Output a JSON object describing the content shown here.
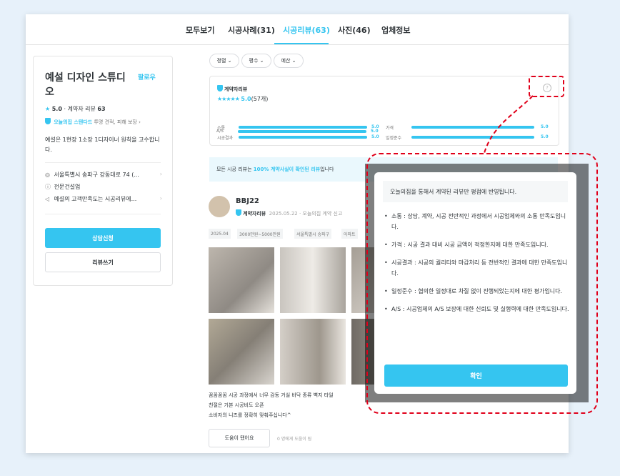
{
  "tabs": [
    {
      "label": "모두보기"
    },
    {
      "label": "시공사례(31)"
    },
    {
      "label": "시공리뷰(63)",
      "active": true
    },
    {
      "label": "사진(46)"
    },
    {
      "label": "업체정보"
    }
  ],
  "business": {
    "name": "예설 디자인 스튜디오",
    "follow_label": "팔로우",
    "rating": "5.0",
    "contract_reviews_prefix": "· 계약자 리뷰",
    "contract_reviews_count": "63",
    "standard_label": "오늘의집 스탠다드",
    "standard_desc": "투명 견적, 피해 보장",
    "description": "예설은 1현장 1소장 1디자이너 원칙을 고수합니다.",
    "address": "서울특별시 송파구 강동대로 74 (...",
    "license": "전문건설업",
    "satisfaction": "예설의 고객만족도는 시공리뷰에...",
    "consult_button": "상담신청",
    "write_review_button": "리뷰쓰기"
  },
  "filters": [
    "정렬",
    "평수",
    "예산"
  ],
  "summary": {
    "title": "계약자리뷰",
    "stars": "★★★★★",
    "score": "5.0",
    "count": "(57개)",
    "help_icon": "?",
    "bars": [
      {
        "label": "소통",
        "value": "5.0"
      },
      {
        "label": "가격",
        "value": "5.0"
      },
      {
        "label": "시공결과",
        "value": "5.0"
      },
      {
        "label": "일정준수",
        "value": "5.0"
      },
      {
        "label": "A/S",
        "value": "5.0"
      }
    ]
  },
  "notice": {
    "prefix": "모든 시공 리뷰는",
    "highlight": "100% 계약사실이 확인된 리뷰",
    "suffix": "입니다"
  },
  "review": {
    "author": "BBJ22",
    "badge": "계약자리뷰",
    "meta": "2025.05.22 · 오늘의집 계약 신고",
    "chips": [
      "2025.04",
      "3000만원~5000만원",
      "서울특별시 송파구",
      "아파트"
    ],
    "text_line1": "꼼꼼꼼꼼 시공 과정에서 너무 감동 거실 바닥 종류 벽지 타일",
    "text_line2": "친절은 기본 시공비도 오픈",
    "text_line3": "소비자의 니즈를 정확히 맞춰주십니다^",
    "helpful_button": "도움이 됐어요",
    "helpful_count": "0 명에게 도움이 됨"
  },
  "modal": {
    "header": "오늘의집을 통해서 계약된 리뷰만 평점에 반영됩니다.",
    "items": [
      "소통 : 상담, 계약, 시공 전반적인 과정에서 시공업체와의 소통 만족도입니다.",
      "가격 : 시공 결과 대비 시공 금액이 적정한지에 대한 만족도입니다.",
      "시공결과 : 시공의 퀄리티와 마감처리 등 전반적인 결과에 대한 만족도입니다.",
      "일정준수 : 협의한 일정대로 차질 없이 진행되었는지에 대한 평가입니다.",
      "A/S : 시공업체의 A/S 보장에 대한 신뢰도 및 실행력에 대한 만족도입니다."
    ],
    "confirm_button": "확인"
  },
  "colors": {
    "accent": "#35c5f0",
    "annotation": "#e0001a",
    "background": "#e7f1fa"
  }
}
